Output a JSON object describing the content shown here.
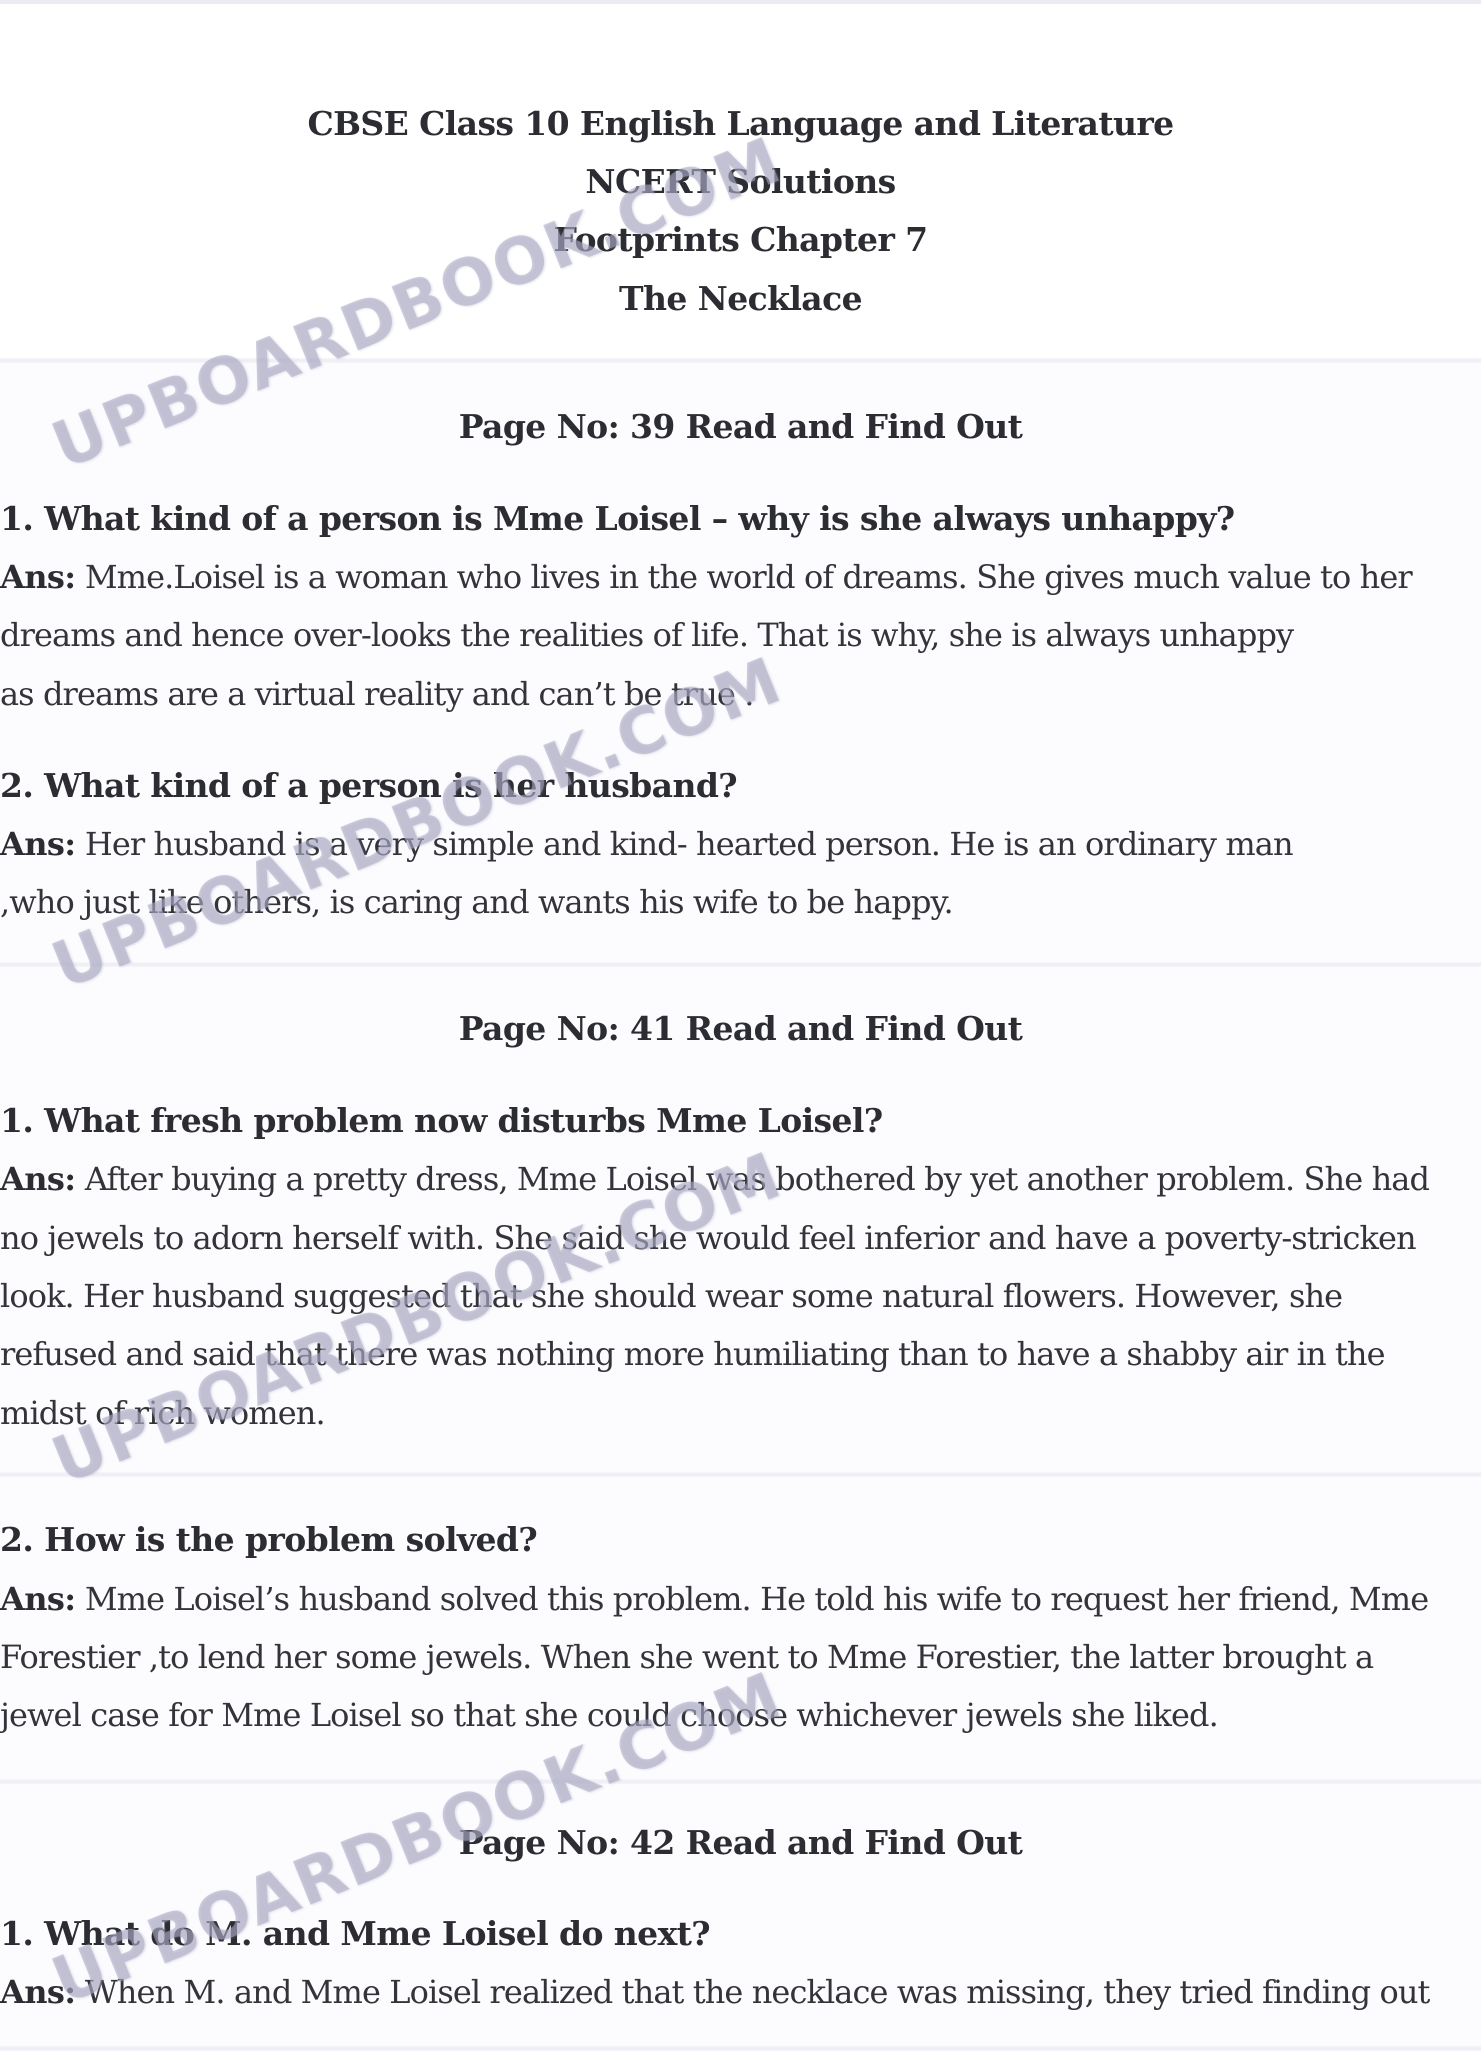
{
  "header": {
    "lines": [
      "CBSE Class 10 English Language and Literature",
      "NCERT Solutions",
      "Footprints Chapter 7",
      "The Necklace"
    ]
  },
  "watermark_text": "UPBOARDBOOK.COM",
  "answer_label": "Ans:",
  "sections": [
    {
      "heading": "Page No: 39 Read and Find Out",
      "questions": [
        {
          "question": "1. What kind of a person is Mme Loisel – why is she always unhappy?",
          "answer_lines": [
            "Mme.Loisel is a woman who lives in the world of dreams. She gives much value to her",
            "dreams and hence over-looks the realities of life. That is why, she is always unhappy",
            "as dreams are  a virtual reality and can’t be true ."
          ]
        },
        {
          "question": "2. What kind of a person is her husband?",
          "answer_lines": [
            "Her husband is a very simple and kind- hearted person. He is an ordinary man",
            ",who just like others, is caring and wants his wife to be happy."
          ]
        }
      ]
    },
    {
      "heading": "Page No: 41 Read and Find Out",
      "questions": [
        {
          "question": "1. What fresh problem now disturbs Mme Loisel?",
          "answer_lines": [
            "After buying a pretty dress, Mme Loisel was bothered by yet another problem. She had",
            "no jewels to adorn herself with. She said she would feel inferior and have a poverty-stricken",
            "look. Her husband suggested that she should wear some natural flowers. However, she",
            "refused and said that there was nothing more humiliating than to have a shabby air in the",
            "midst of rich women."
          ]
        },
        {
          "question": "2. How is the problem solved?",
          "answer_lines": [
            "Mme Loisel’s husband solved this problem. He told his wife to request her friend, Mme",
            "Forestier ,to lend her some jewels. When she went to Mme Forestier, the latter brought a",
            "jewel case for Mme Loisel so that she could choose whichever jewels she liked."
          ]
        }
      ]
    },
    {
      "heading": "Page No: 42 Read and Find Out",
      "questions": [
        {
          "question": "1. What do M. and Mme Loisel do next?",
          "answer_lines": [
            "When M. and Mme Loisel realized that the necklace was missing, they tried finding out"
          ]
        }
      ]
    }
  ]
}
